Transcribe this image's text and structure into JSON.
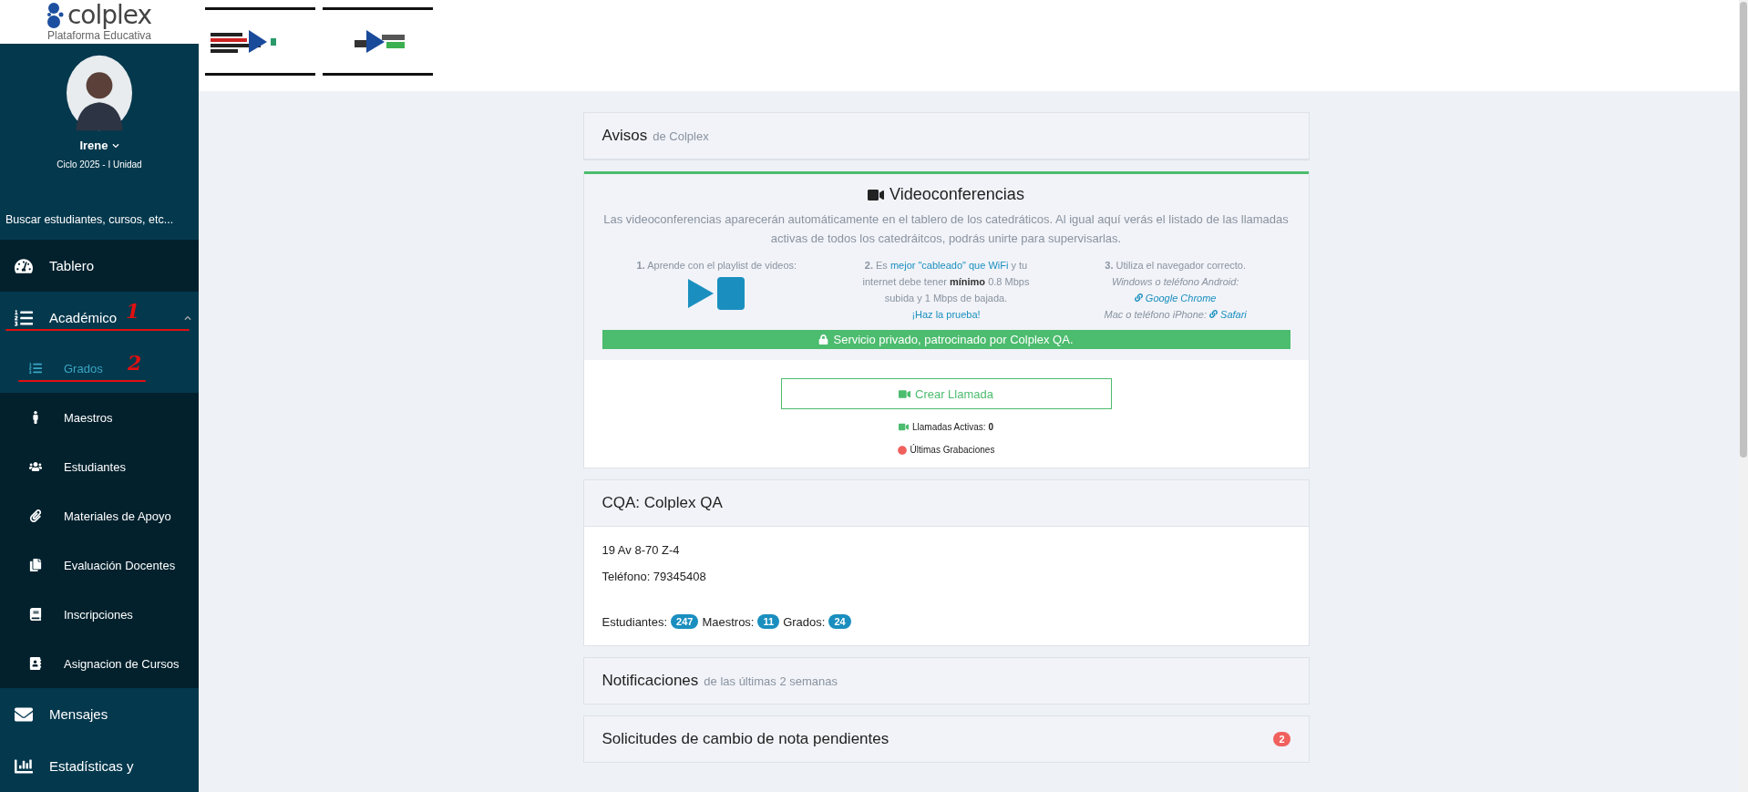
{
  "brand": {
    "name": "colplex",
    "tagline": "Plataforma Educativa"
  },
  "profile": {
    "name": "Irene",
    "cycle": "Ciclo 2025 - I Unidad"
  },
  "search": {
    "placeholder": "Buscar estudiantes, cursos, etc..."
  },
  "nav": [
    {
      "label": "Tablero",
      "selected": false
    },
    {
      "label": "Académico",
      "selected": false,
      "expanded": true,
      "annotation": "1",
      "children": [
        {
          "label": "Grados",
          "selected": true,
          "annotation": "2"
        },
        {
          "label": "Maestros",
          "selected": false
        },
        {
          "label": "Estudiantes",
          "selected": false
        },
        {
          "label": "Materiales de Apoyo",
          "selected": false
        },
        {
          "label": "Evaluación Docentes",
          "selected": false
        },
        {
          "label": "Inscripciones",
          "selected": false
        },
        {
          "label": "Asignacion de Cursos",
          "selected": false
        }
      ]
    },
    {
      "label": "Mensajes",
      "selected": false
    },
    {
      "label": "Estadísticas y",
      "selected": false
    }
  ],
  "notices": {
    "title": "Avisos",
    "subtitle": "de Colplex"
  },
  "video_panel": {
    "title": "Videoconferencias",
    "description": "Las videoconferencias aparecerán automáticamente en el tablero de los catedráticos. Al igual aquí verás el listado de las llamadas activas de todos los catedráitcos, podrás unirte para supervisarlas.",
    "tips": [
      {
        "parts": [
          {
            "kind": "bold",
            "text": "1."
          },
          {
            "kind": "plain",
            "text": " Aprende con el playlist de videos:"
          }
        ],
        "kind": "video"
      },
      {
        "parts": [
          {
            "kind": "bold",
            "text": "2."
          },
          {
            "kind": "plain",
            "text": " Es "
          },
          {
            "kind": "link",
            "text": "mejor \"cableado\" que WiFi"
          },
          {
            "kind": "plain",
            "text": " y tu internet debe tener "
          },
          {
            "kind": "strong",
            "text": "mínimo"
          },
          {
            "kind": "plain",
            "text": " 0.8 Mbps subida y 1 Mbps de bajada."
          },
          {
            "kind": "break"
          },
          {
            "kind": "link",
            "text": "¡Haz la prueba!"
          }
        ],
        "kind": "text"
      },
      {
        "parts": [
          {
            "kind": "bold",
            "text": "3."
          },
          {
            "kind": "plain",
            "text": " Utiliza el navegador correcto."
          },
          {
            "kind": "break"
          },
          {
            "kind": "italic",
            "text": "Windows o teléfono Android:"
          },
          {
            "kind": "break"
          },
          {
            "kind": "chain-link",
            "text": "Google Chrome"
          },
          {
            "kind": "break"
          },
          {
            "kind": "italic",
            "text": "Mac o teléfono iPhone: "
          },
          {
            "kind": "chain-link",
            "text": "Safari"
          }
        ],
        "kind": "text"
      }
    ],
    "banner": "Servicio privado, patrocinado por Colplex QA.",
    "create_button": "Crear Llamada",
    "active_calls_label": "Llamadas Activas:",
    "active_calls": "0",
    "recordings": "Últimas Grabaciones"
  },
  "school": {
    "title": "CQA: Colplex QA",
    "address": "19 Av 8-70 Z-4",
    "phone": "Teléfono: 79345408",
    "stats": [
      {
        "label": "Estudiantes:",
        "count": "247"
      },
      {
        "label": "Maestros:",
        "count": "11"
      },
      {
        "label": "Grados:",
        "count": "24"
      }
    ]
  },
  "notifications": {
    "title": "Notificaciones",
    "subtitle": "de las últimas 2 semanas"
  },
  "requests": {
    "title": "Solicitudes de cambio de nota pendientes",
    "count": "2"
  }
}
